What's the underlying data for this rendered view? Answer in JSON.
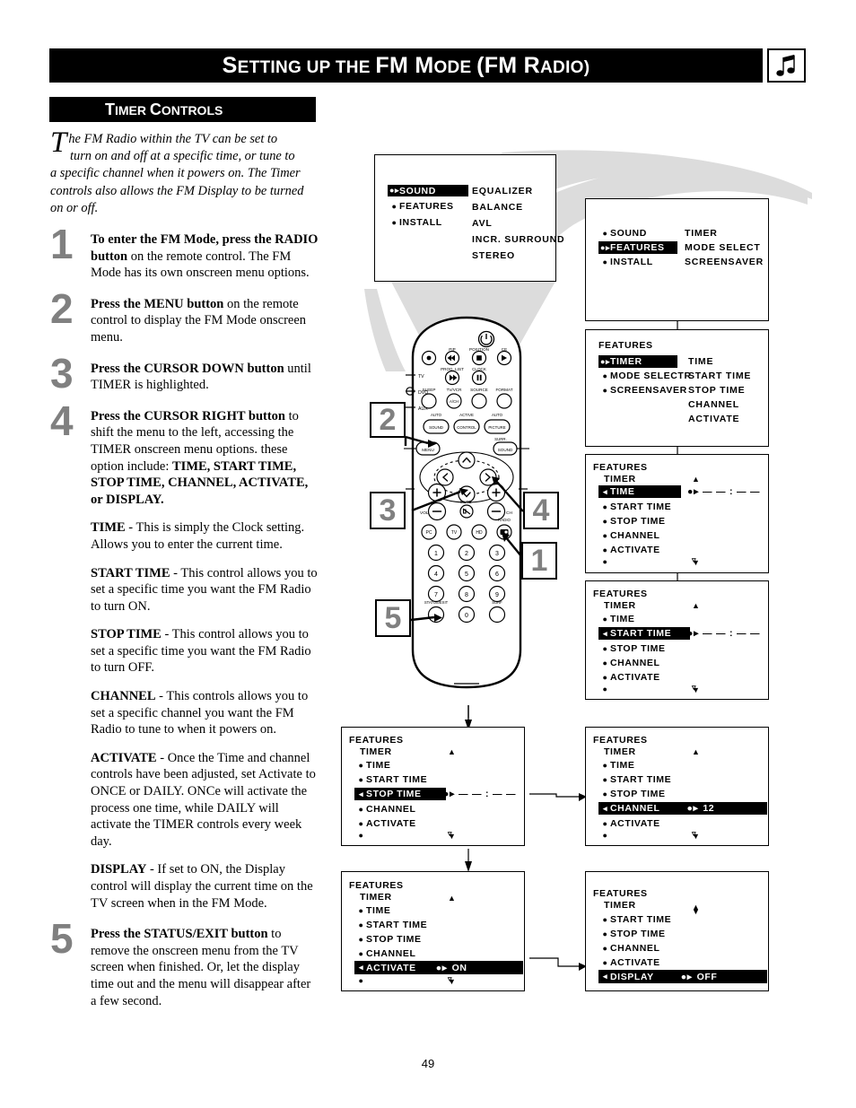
{
  "header": {
    "title_parts": [
      "S",
      "ETTING UP THE ",
      "FM M",
      "ODE ",
      "(FM R",
      "ADIO)"
    ],
    "title": "Setting up the FM Mode (FM Radio)",
    "icon": "music-note-icon"
  },
  "section": {
    "title": "Timer Controls",
    "title_parts": [
      "T",
      "IMER ",
      "C",
      "ONTROLS"
    ]
  },
  "intro": {
    "dropcap": "T",
    "line1": "he FM Radio within the TV can be set to",
    "line2": "turn on and off at a specific time, or tune to",
    "rest": "a specific channel when it powers on. The Timer controls also allows the FM Display to be turned on or off."
  },
  "steps": [
    {
      "num": "1",
      "bold1": "To enter the FM Mode, press the RADIO button",
      "rest": " on the remote control. The FM Mode has its own onscreen menu options."
    },
    {
      "num": "2",
      "bold1": "Press the MENU button",
      "rest": " on the remote control to display the FM Mode onscreen menu."
    },
    {
      "num": "3",
      "bold1": "Press the CURSOR DOWN button",
      "rest": " until TIMER is highlighted."
    },
    {
      "num": "4",
      "bold1": "Press the CURSOR RIGHT button",
      "rest": " to shift the menu to the left, accessing the TIMER onscreen menu options. these option include: ",
      "bold2": "TIME, START TIME, STOP TIME, CHANNEL, ACTIVATE, or DISPLAY."
    },
    {
      "num": "5",
      "bold1": "Press the STATUS/EXIT button",
      "rest": " to remove the onscreen menu from the TV screen when finished. Or, let the display time out and the menu will disappear after a few second."
    }
  ],
  "definitions": [
    {
      "term": "TIME",
      "text": " - This is simply the Clock setting. Allows you to enter the current time."
    },
    {
      "term": "START TIME",
      "text": " - This control allows you to set a specific time you want the FM Radio to turn ON."
    },
    {
      "term": "STOP TIME",
      "text": " - This control allows you to set a specific time you want the FM Radio to turn OFF."
    },
    {
      "term": "CHANNEL",
      "text": " - This controls allows you to set a specific channel you want the FM Radio to tune to when it powers on."
    },
    {
      "term": "ACTIVATE",
      "text": " - Once the Time and channel controls have been adjusted, set Activate to ONCE or DAILY. ONCe will activate the process one time, while DAILY will activate the TIMER controls every week day."
    },
    {
      "term": "DISPLAY",
      "text": " - If set to ON, the Display control will display the current time on the TV screen when in the FM Mode."
    }
  ],
  "osd_menus": [
    {
      "id": "menu-sound",
      "header": "",
      "subheader": "",
      "left_items": [
        {
          "label": "SOUND",
          "highlighted": true,
          "marker": "updown-right"
        },
        {
          "label": "FEATURES",
          "highlighted": false,
          "marker": "dot"
        },
        {
          "label": "INSTALL",
          "highlighted": false,
          "marker": "dot"
        }
      ],
      "right_items": [
        "EQUALIZER",
        "BALANCE",
        "AVL",
        "INCR. SURROUND",
        "STEREO"
      ]
    },
    {
      "id": "menu-features",
      "header": "",
      "subheader": "",
      "left_items": [
        {
          "label": "SOUND",
          "highlighted": false,
          "marker": "dot"
        },
        {
          "label": "FEATURES",
          "highlighted": true,
          "marker": "updown-right"
        },
        {
          "label": "INSTALL",
          "highlighted": false,
          "marker": "dot"
        }
      ],
      "right_items": [
        "TIMER",
        "MODE SELECT",
        "SCREENSAVER"
      ]
    },
    {
      "id": "menu-features-timer",
      "header": "FEATURES",
      "subheader": "",
      "left_items": [
        {
          "label": "TIMER",
          "highlighted": true,
          "marker": "updown-right"
        },
        {
          "label": "MODE SELECTR",
          "highlighted": false,
          "marker": "dot"
        },
        {
          "label": "SCREENSAVER",
          "highlighted": false,
          "marker": "dot"
        }
      ],
      "right_items": [
        "TIME",
        "START TIME",
        "STOP TIME",
        "CHANNEL",
        "ACTIVATE"
      ]
    },
    {
      "id": "menu-timer-time",
      "header": "FEATURES",
      "subheader": "TIMER",
      "scroll_up": true,
      "scroll_down": true,
      "left_items": [
        {
          "label": "TIME",
          "highlighted": true,
          "marker": "left-arrow",
          "value": "— — : — —"
        },
        {
          "label": "START TIME",
          "highlighted": false,
          "marker": "dot"
        },
        {
          "label": "STOP TIME",
          "highlighted": false,
          "marker": "dot"
        },
        {
          "label": "CHANNEL",
          "highlighted": false,
          "marker": "dot"
        },
        {
          "label": "ACTIVATE",
          "highlighted": false,
          "marker": "dot"
        },
        {
          "label": "",
          "highlighted": false,
          "marker": "dot"
        }
      ]
    },
    {
      "id": "menu-timer-start-time",
      "header": "FEATURES",
      "subheader": "TIMER",
      "scroll_up": true,
      "scroll_down": true,
      "left_items": [
        {
          "label": "TIME",
          "highlighted": false,
          "marker": "dot"
        },
        {
          "label": "START TIME",
          "highlighted": true,
          "marker": "left-arrow",
          "value": "— — : — —"
        },
        {
          "label": "STOP TIME",
          "highlighted": false,
          "marker": "dot"
        },
        {
          "label": "CHANNEL",
          "highlighted": false,
          "marker": "dot"
        },
        {
          "label": "ACTIVATE",
          "highlighted": false,
          "marker": "dot"
        },
        {
          "label": "",
          "highlighted": false,
          "marker": "dot"
        }
      ]
    },
    {
      "id": "menu-timer-stop-time",
      "header": "FEATURES",
      "subheader": "TIMER",
      "scroll_up": true,
      "scroll_down": true,
      "left_items": [
        {
          "label": "TIME",
          "highlighted": false,
          "marker": "dot"
        },
        {
          "label": "START TIME",
          "highlighted": false,
          "marker": "dot"
        },
        {
          "label": "STOP TIME",
          "highlighted": true,
          "marker": "left-arrow",
          "value": "— — : — —"
        },
        {
          "label": "CHANNEL",
          "highlighted": false,
          "marker": "dot"
        },
        {
          "label": "ACTIVATE",
          "highlighted": false,
          "marker": "dot"
        },
        {
          "label": "",
          "highlighted": false,
          "marker": "dot"
        }
      ]
    },
    {
      "id": "menu-timer-channel",
      "header": "FEATURES",
      "subheader": "TIMER",
      "scroll_up": true,
      "scroll_down": true,
      "left_items": [
        {
          "label": "TIME",
          "highlighted": false,
          "marker": "dot"
        },
        {
          "label": "START TIME",
          "highlighted": false,
          "marker": "dot"
        },
        {
          "label": "STOP TIME",
          "highlighted": false,
          "marker": "dot"
        },
        {
          "label": "CHANNEL",
          "highlighted": true,
          "marker": "left-arrow",
          "value": "12"
        },
        {
          "label": "ACTIVATE",
          "highlighted": false,
          "marker": "dot"
        },
        {
          "label": "",
          "highlighted": false,
          "marker": "dot"
        }
      ]
    },
    {
      "id": "menu-timer-activate",
      "header": "FEATURES",
      "subheader": "TIMER",
      "scroll_up": true,
      "scroll_down": true,
      "left_items": [
        {
          "label": "TIME",
          "highlighted": false,
          "marker": "dot"
        },
        {
          "label": "START TIME",
          "highlighted": false,
          "marker": "dot"
        },
        {
          "label": "STOP TIME",
          "highlighted": false,
          "marker": "dot"
        },
        {
          "label": "CHANNEL",
          "highlighted": false,
          "marker": "dot"
        },
        {
          "label": "ACTIVATE",
          "highlighted": true,
          "marker": "left-arrow",
          "value": "ON"
        },
        {
          "label": "",
          "highlighted": false,
          "marker": "dot"
        }
      ]
    },
    {
      "id": "menu-timer-display",
      "header": "FEATURES",
      "subheader": "TIMER",
      "scroll_up": true,
      "scroll_down": false,
      "left_items": [
        {
          "label": "START TIME",
          "highlighted": false,
          "marker": "dot"
        },
        {
          "label": "STOP TIME",
          "highlighted": false,
          "marker": "dot"
        },
        {
          "label": "CHANNEL",
          "highlighted": false,
          "marker": "dot"
        },
        {
          "label": "ACTIVATE",
          "highlighted": false,
          "marker": "dot"
        },
        {
          "label": "DISPLAY",
          "highlighted": true,
          "marker": "left-arrow",
          "value": "OFF"
        }
      ]
    }
  ],
  "osd_text": {
    "m1_r1": "SOUND",
    "m1_r2": "FEATURES",
    "m1_r3": "INSTALL",
    "m1_c1": "EQUALIZER",
    "m1_c2": "BALANCE",
    "m1_c3": "AVL",
    "m1_c4": "INCR. SURROUND",
    "m1_c5": "STEREO",
    "m2_r1": "SOUND",
    "m2_r2": "FEATURES",
    "m2_r3": "INSTALL",
    "m2_c1": "TIMER",
    "m2_c2": "MODE SELECT",
    "m2_c3": "SCREENSAVER",
    "m3_h": "FEATURES",
    "m3_r1": "TIMER",
    "m3_r2": "MODE SELECTR",
    "m3_r3": "SCREENSAVER",
    "m3_c1": "TIME",
    "m3_c2": "START TIME",
    "m3_c3": "STOP TIME",
    "m3_c4": "CHANNEL",
    "m3_c5": "ACTIVATE",
    "hdr_features": "FEATURES",
    "hdr_timer": "TIMER",
    "i_time": "TIME",
    "i_start": "START TIME",
    "i_stop": "STOP TIME",
    "i_channel": "CHANNEL",
    "i_activate": "ACTIVATE",
    "i_display": "DISPLAY",
    "v_blank_time": "— — : — —",
    "v_channel": "12",
    "v_on": "ON",
    "v_off": "OFF"
  },
  "remote": {
    "name": "tv-remote-control",
    "side_labels": [
      "TV",
      "DVD",
      "AUX"
    ],
    "buttons": {
      "power": "power-icon",
      "row1_top_labels": [
        "PIP",
        "POSITION",
        "CE"
      ],
      "row2_top_labels": [
        "PROG. LIST",
        "CLOCK"
      ],
      "row3_labels": [
        "SLEEP",
        "TV/VCR",
        "SOURCE",
        "FORMAT"
      ],
      "row3_sub": "A/CH",
      "row4_top": [
        "AUTO",
        "ACTIVE",
        "AUTO"
      ],
      "row4_labels": [
        "SOUND",
        "CONTROL",
        "PICTURE"
      ],
      "surr": "SURR.",
      "menu": "MENU",
      "sound": "SOUND",
      "vol": "VOL",
      "ch": "CH",
      "mute": "MUTE",
      "source_row": [
        "PC",
        "TV",
        "HD"
      ],
      "radio": "RADIO",
      "digits": [
        "1",
        "2",
        "3",
        "4",
        "5",
        "6",
        "7",
        "8",
        "9",
        "0"
      ],
      "status_exit": "STATUS/EXIT",
      "surf": "SURF"
    }
  },
  "callouts": [
    {
      "num": "1",
      "target": "radio-button"
    },
    {
      "num": "2",
      "target": "menu-button"
    },
    {
      "num": "3",
      "target": "cursor-down-button"
    },
    {
      "num": "4",
      "target": "cursor-right-button"
    },
    {
      "num": "5",
      "target": "status-exit-button"
    }
  ],
  "footer": {
    "page_number": "49"
  },
  "colors": {
    "accent": "#000000",
    "step_number": "#808080",
    "funnel": "#d9d9d9"
  }
}
